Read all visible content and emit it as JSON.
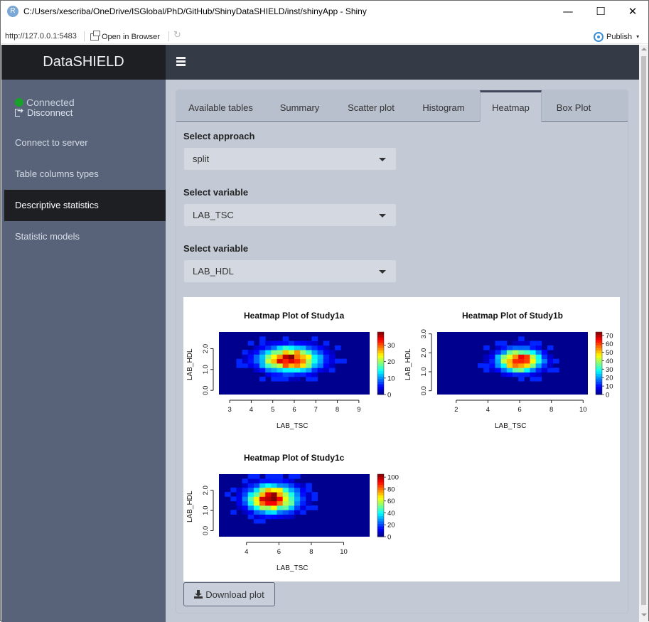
{
  "window": {
    "icon_letter": "R",
    "title": "C:/Users/xescriba/OneDrive/ISGlobal/PhD/GitHub/ShinyDataSHIELD/inst/shinyApp - Shiny",
    "minimize_glyph": "—",
    "maximize_glyph": "☐",
    "close_glyph": "✕"
  },
  "toolbar": {
    "url": "http://127.0.0.1:5483",
    "open_in_browser": "Open in Browser",
    "refresh_glyph": "↻",
    "publish": "Publish",
    "publish_caret": "▾"
  },
  "header": {
    "brand": "DataSHIELD"
  },
  "sidebar": {
    "status": "Connected",
    "disconnect": "Disconnect",
    "items": [
      {
        "label": "Connect to server"
      },
      {
        "label": "Table columns types"
      },
      {
        "label": "Descriptive statistics"
      },
      {
        "label": "Statistic models"
      }
    ]
  },
  "tabs": [
    {
      "label": "Available tables"
    },
    {
      "label": "Summary"
    },
    {
      "label": "Scatter plot"
    },
    {
      "label": "Histogram"
    },
    {
      "label": "Heatmap"
    },
    {
      "label": "Box Plot"
    }
  ],
  "active_tab": "Heatmap",
  "form": {
    "approach_label": "Select approach",
    "approach_value": "split",
    "var1_label": "Select variable",
    "var1_value": "LAB_TSC",
    "var2_label": "Select variable",
    "var2_value": "LAB_HDL"
  },
  "download_button": "Download plot",
  "colors": {
    "sidebar_bg": "#58637a",
    "header_bg": "#353a47",
    "brand_bg": "#1e1f23",
    "content_bg": "#c3cad6",
    "status_green": "#17a22a"
  },
  "chart_data": [
    {
      "type": "heatmap",
      "title": "Heatmap Plot of Study1a",
      "xlabel": "LAB_TSC",
      "ylabel": "LAB_HDL",
      "xticks": [
        "3",
        "4",
        "5",
        "6",
        "7",
        "8",
        "9"
      ],
      "yticks": [
        "0.0",
        "1.0",
        "2.0"
      ],
      "xlim": [
        2.5,
        9.5
      ],
      "ylim": [
        -0.2,
        2.8
      ],
      "center": [
        5.8,
        1.5
      ],
      "spread": [
        0.9,
        0.4
      ],
      "legend_ticks": [
        "0",
        "10",
        "20",
        "30"
      ],
      "legend_max": 38
    },
    {
      "type": "heatmap",
      "title": "Heatmap Plot of Study1b",
      "xlabel": "LAB_TSC",
      "ylabel": "LAB_HDL",
      "xticks": [
        "2",
        "4",
        "6",
        "8",
        "10"
      ],
      "yticks": [
        "0.0",
        "1.0",
        "2.0",
        "3.0"
      ],
      "xlim": [
        0.8,
        10.3
      ],
      "ylim": [
        -0.2,
        3.1
      ],
      "center": [
        6.0,
        1.6
      ],
      "spread": [
        0.9,
        0.4
      ],
      "legend_ticks": [
        "0",
        "10",
        "20",
        "30",
        "40",
        "50",
        "60",
        "70"
      ],
      "legend_max": 74
    },
    {
      "type": "heatmap",
      "title": "Heatmap Plot of Study1c",
      "xlabel": "LAB_TSC",
      "ylabel": "LAB_HDL",
      "xticks": [
        "4",
        "6",
        "8",
        "10"
      ],
      "yticks": [
        "0.0",
        "1.0",
        "2.0"
      ],
      "xlim": [
        2.3,
        11.6
      ],
      "ylim": [
        -0.3,
        2.8
      ],
      "center": [
        5.6,
        1.6
      ],
      "spread": [
        1.0,
        0.45
      ],
      "legend_ticks": [
        "0",
        "20",
        "40",
        "60",
        "80",
        "100"
      ],
      "legend_max": 105
    }
  ]
}
